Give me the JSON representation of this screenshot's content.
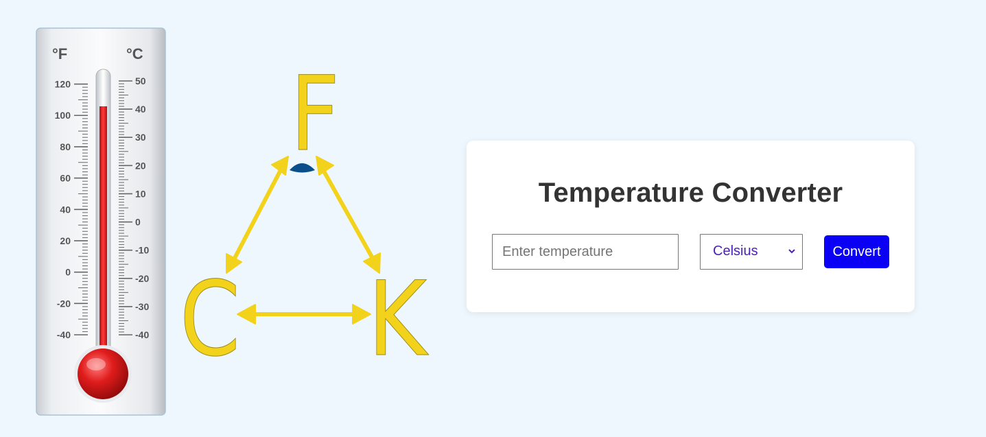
{
  "hero": {
    "thermometer": {
      "fahrenheit_unit": "°F",
      "celsius_unit": "°C",
      "fahrenheit_ticks": [
        "120",
        "100",
        "80",
        "60",
        "40",
        "20",
        "0",
        "-20",
        "-40"
      ],
      "celsius_ticks": [
        "50",
        "40",
        "30",
        "20",
        "10",
        "0",
        "-10",
        "-20",
        "-30",
        "-40"
      ],
      "mercury_level_celsius": 41,
      "mercury_color": "#d62020"
    },
    "conversion_diagram": {
      "top_letter": "F",
      "left_letter": "C",
      "right_letter": "K",
      "letter_color": "#f2d21a",
      "center_mark_color": "#0b4f8a"
    }
  },
  "converter": {
    "title": "Temperature Converter",
    "input_placeholder": "Enter temperature",
    "input_value": "",
    "unit_selected": "Celsius",
    "convert_label": "Convert",
    "button_color": "#0a00f5"
  }
}
